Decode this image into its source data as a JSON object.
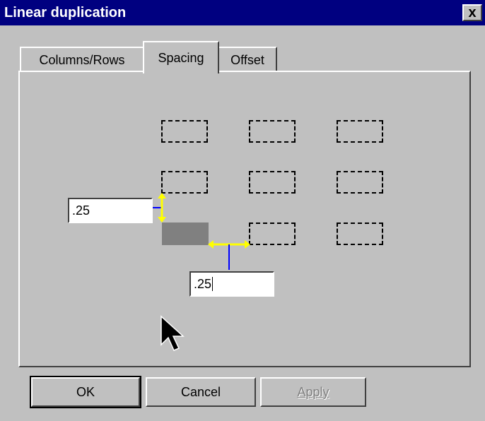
{
  "window": {
    "title": "Linear duplication",
    "close_glyph": "x"
  },
  "tabs": [
    {
      "label": "Columns/Rows",
      "active": false
    },
    {
      "label": "Spacing",
      "active": true
    },
    {
      "label": "Offset",
      "active": false
    }
  ],
  "spacing": {
    "vertical_value": ".25",
    "horizontal_value": ".25"
  },
  "buttons": {
    "ok": "OK",
    "cancel": "Cancel",
    "apply": "Apply"
  },
  "colors": {
    "title_bar": "#000080",
    "dialog_bg": "#c0c0c0",
    "arrow": "#ffff00",
    "leader": "#0000ff",
    "source_box": "#808080"
  },
  "icons": {
    "cursor": "mouse-pointer-icon",
    "close": "close-icon"
  }
}
